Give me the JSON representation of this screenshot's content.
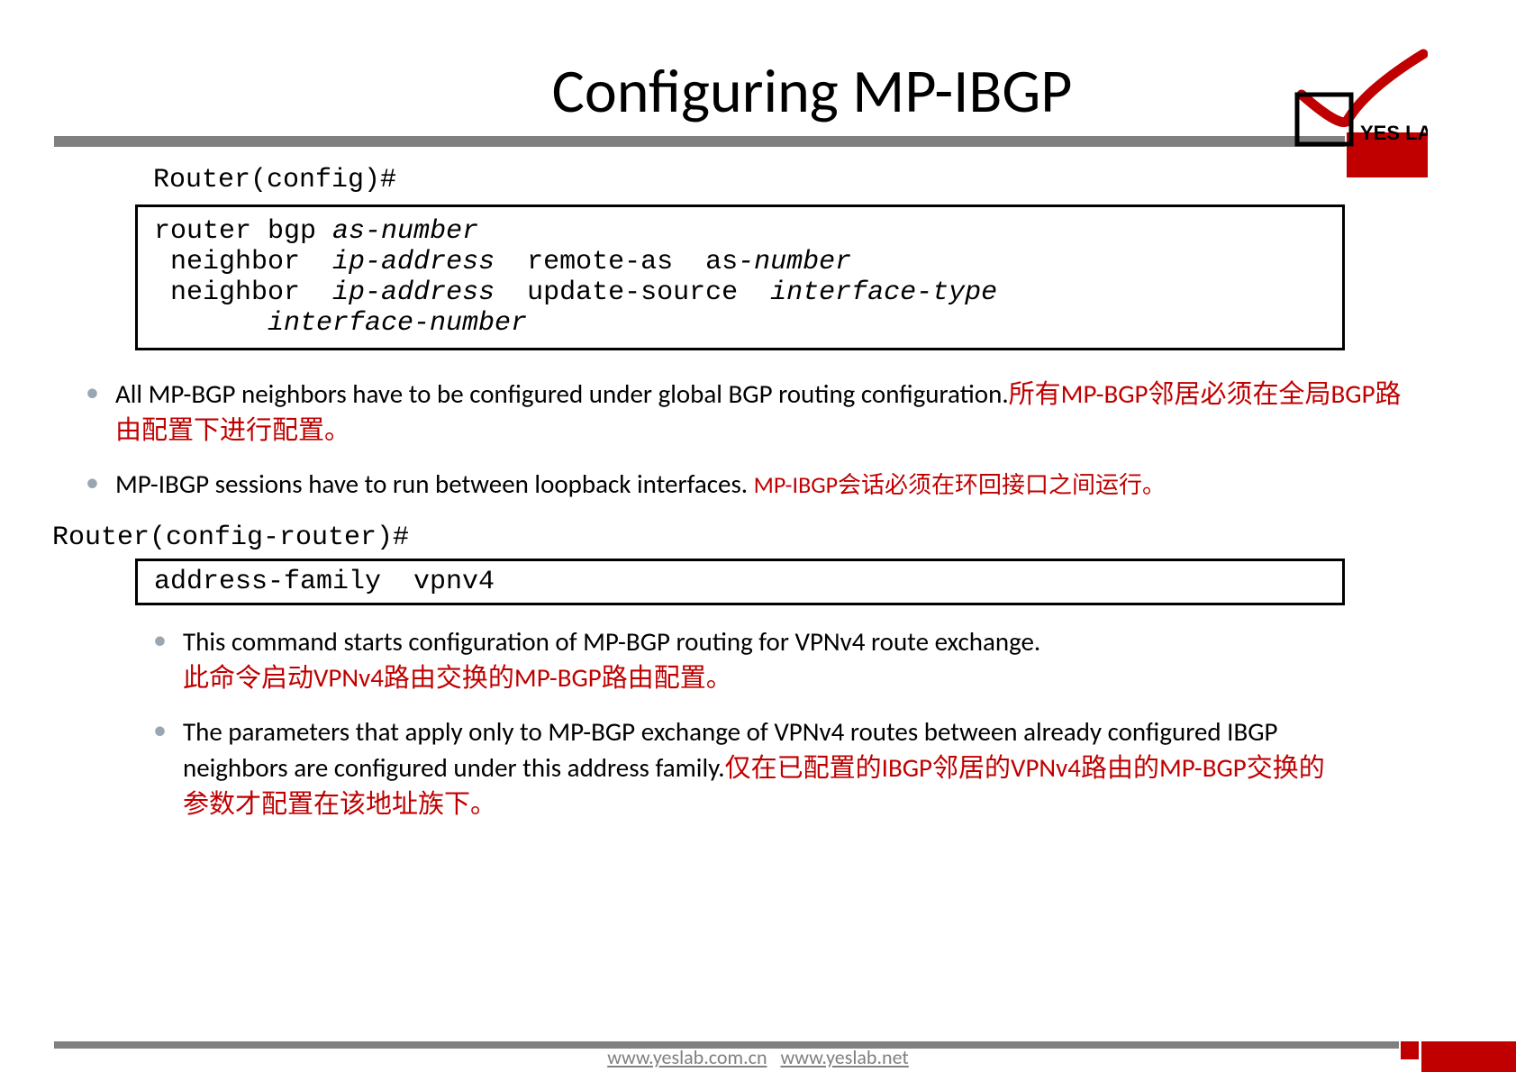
{
  "title": "Configuring MP-IBGP",
  "logo_text": "YES LAB",
  "prompt1": "Router(config)#",
  "code1": {
    "l1a": "router bgp ",
    "l1b": "as-number",
    "l2a": " neighbor  ",
    "l2b": "ip-address",
    "l2c": "  remote-as  as",
    "l2d": "-number",
    "l3a": " neighbor  ",
    "l3b": "ip-address",
    "l3c": "  update-source  ",
    "l3d": "interface-type",
    "l4a": "       interface-number"
  },
  "bullets1": [
    {
      "en": "All MP-BGP neighbors have to be configured under global BGP routing  configuration.",
      "zh": "所有MP-BGP邻居必须在全局BGP路由配置下进行配置。"
    },
    {
      "en": "MP-IBGP sessions  have to run between loopback interfaces. ",
      "zh_sm": "MP-IBGP会话必须在环回接口之间运行。"
    }
  ],
  "prompt2": "Router(config-router)#",
  "code2": "address-family  vpnv4",
  "bullets2": [
    {
      "en": "This command starts configuration of MP-BGP routing for VPNv4 route exchange.",
      "zh": "此命令启动VPNv4路由交换的MP-BGP路由配置。"
    },
    {
      "en": "The parameters that apply only to MP-BGP exchange of VPNv4 routes between already configured IBGP neighbors are configured under this address family.",
      "zh": "仅在已配置的IBGP邻居的VPNv4路由的MP-BGP交换的参数才配置在该地址族下。"
    }
  ],
  "footer": {
    "link1": "www.yeslab.com.cn",
    "link2": "www.yeslab.net"
  }
}
